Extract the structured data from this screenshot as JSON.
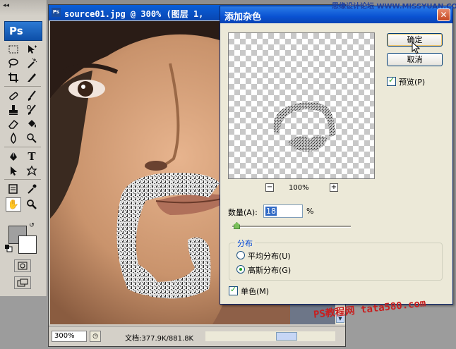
{
  "document": {
    "title": "source01.jpg @ 300% (图层 1,",
    "zoom": "300%",
    "doc_size": "文档:377.9K/881.8K"
  },
  "tools": {
    "collapse_glyph": "◂◂",
    "logo": "Ps"
  },
  "dialog": {
    "title": "添加杂色",
    "close_glyph": "✕",
    "ok_label": "确定",
    "cancel_label": "取消",
    "preview_label": "预览(P)",
    "preview_checked": true,
    "zoom_value": "100%",
    "zoom_out": "−",
    "zoom_in": "+",
    "amount_label": "数量(A):",
    "amount_value": "18",
    "amount_unit": "%",
    "distribution_legend": "分布",
    "uniform_label": "平均分布(U)",
    "gaussian_label": "高斯分布(G)",
    "selected_distribution": "gaussian",
    "monochromatic_label": "单色(M)",
    "monochromatic_checked": true
  },
  "watermarks": {
    "top_right": "思缘设计论坛 WWW.MISSYUAN.COM",
    "bottom_right": "PS教程网 tata580.com"
  },
  "colors": {
    "foreground": "#a0a0a0",
    "background": "#ffffff",
    "title_blue": "#0a52d2"
  }
}
